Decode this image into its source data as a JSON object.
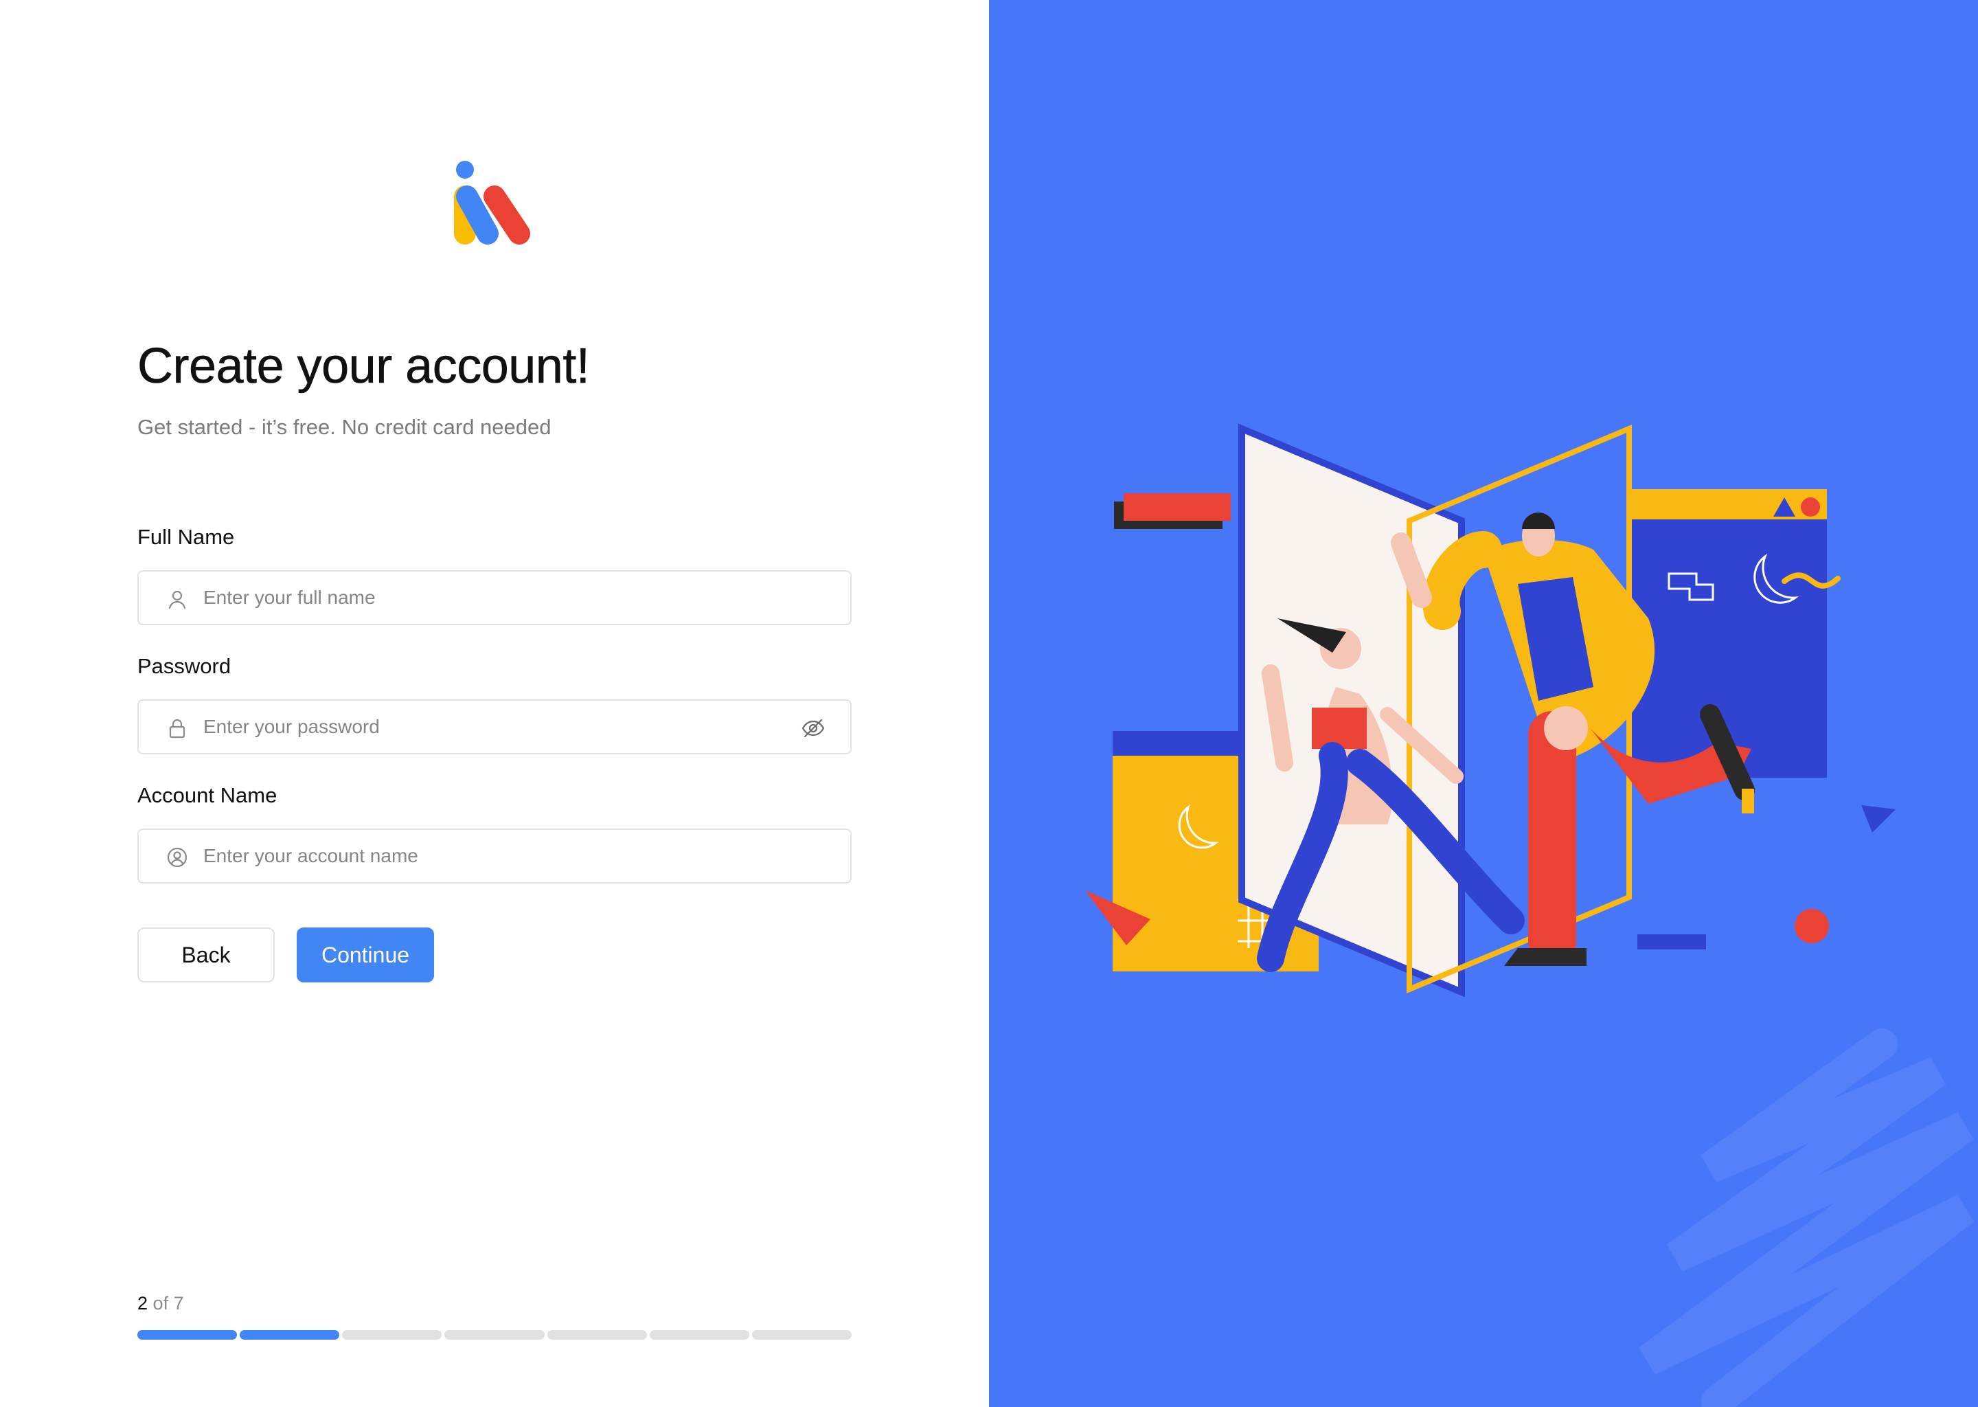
{
  "form": {
    "title": "Create your account!",
    "subtitle": "Get started - it’s free. No credit card needed",
    "full_name": {
      "label": "Full Name",
      "placeholder": "Enter your full name",
      "icon": "user-icon"
    },
    "password": {
      "label": "Password",
      "placeholder": "Enter your password",
      "icon": "lock-icon",
      "toggle_icon": "eye-off-icon"
    },
    "account_name": {
      "label": "Account Name",
      "placeholder": "Enter your account name",
      "icon": "account-circle-icon"
    },
    "back_label": "Back",
    "continue_label": "Continue"
  },
  "progress": {
    "current": "2",
    "of_text": "of 7",
    "total_steps": 7,
    "completed_steps": 2
  },
  "colors": {
    "accent": "#4285f4",
    "right_panel": "#4876f9",
    "logo_blue": "#4285f4",
    "logo_yellow": "#fbbc05",
    "logo_red": "#ea4335"
  }
}
